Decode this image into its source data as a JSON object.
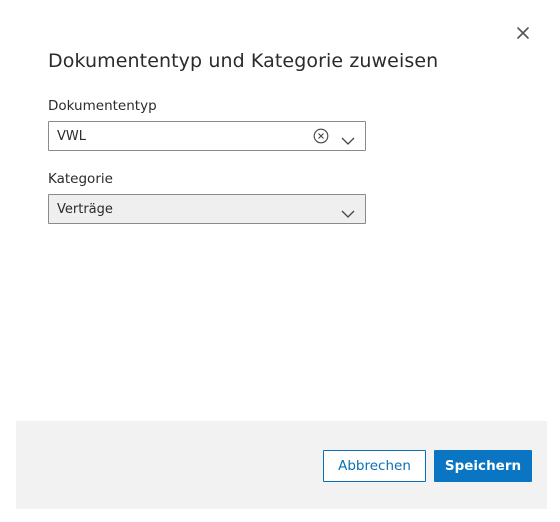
{
  "dialog": {
    "title": "Dokumententyp und Kategorie zuweisen",
    "close_icon": "close-icon"
  },
  "form": {
    "document_type": {
      "label": "Dokumententyp",
      "value": "VWL",
      "clear_icon": "clear-circle-icon",
      "dropdown_icon": "chevron-down-icon"
    },
    "category": {
      "label": "Kategorie",
      "value": "Verträge",
      "dropdown_icon": "chevron-down-icon"
    }
  },
  "footer": {
    "cancel_label": "Abbrechen",
    "save_label": "Speichern"
  },
  "colors": {
    "primary": "#0a75c2",
    "footer_bg": "#f2f2f2",
    "field_disabled_bg": "#efefef"
  }
}
